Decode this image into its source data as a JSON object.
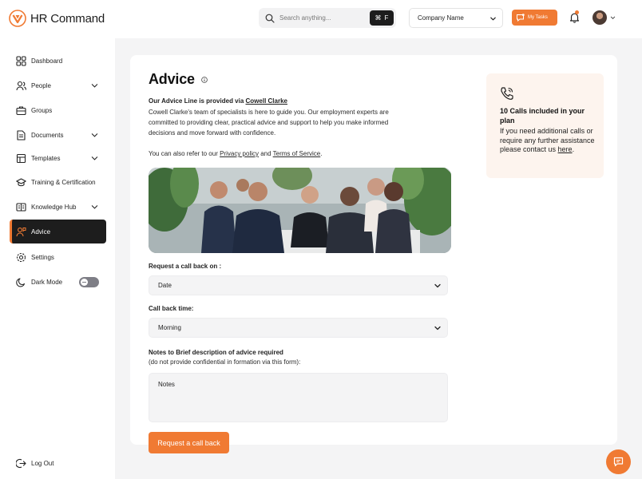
{
  "brand": {
    "name": "HR Command",
    "accent": "#f07a33",
    "dark": "#1d1d1d"
  },
  "header": {
    "search_placeholder": "Search anything...",
    "shortcut_symbol": "⌘",
    "shortcut_key": "F",
    "company_select": "Company Name",
    "tasks_label": "My Tasks",
    "icons": [
      "search-icon",
      "chevron-down-icon",
      "chat-icon",
      "bell-icon",
      "avatar"
    ]
  },
  "sidebar": {
    "items": [
      {
        "label": "Dashboard",
        "icon": "dashboard-icon",
        "has_chevron": false
      },
      {
        "label": "People",
        "icon": "people-icon",
        "has_chevron": true
      },
      {
        "label": "Groups",
        "icon": "briefcase-icon",
        "has_chevron": false
      },
      {
        "label": "Documents",
        "icon": "document-icon",
        "has_chevron": true
      },
      {
        "label": "Templates",
        "icon": "template-icon",
        "has_chevron": true
      },
      {
        "label": "Training & Certification",
        "icon": "graduation-cap-icon",
        "has_chevron": false
      },
      {
        "label": "Knowledge Hub",
        "icon": "book-icon",
        "has_chevron": true
      },
      {
        "label": "Advice",
        "icon": "advice-icon",
        "has_chevron": false,
        "active": true
      },
      {
        "label": "Settings",
        "icon": "gear-icon",
        "has_chevron": false
      },
      {
        "label": "Dark Mode",
        "icon": "moon-icon",
        "has_chevron": false
      }
    ],
    "dark_mode_on": false,
    "logout": "Log Out"
  },
  "page": {
    "title": "Advice",
    "intro_heading_prefix": "Our Advice Line is provided via ",
    "intro_heading_link": "Cowell Clarke",
    "intro_body": "Cowell Clarke's team of specialists is here to guide you. Our employment experts are committed to providing clear, practical advice and support to help you make informed decisions and move forward with confidence.",
    "refer_prefix": "You can also refer to our ",
    "privacy_link": "Privacy policy",
    "refer_and": " and ",
    "terms_link": "Terms of Service",
    "refer_suffix": ".",
    "form": {
      "callback_label": "Request a call back on :",
      "callback_value": "Date",
      "time_label": "Call back time:",
      "time_value": "Morning",
      "notes_label": "Notes to Brief description of advice required",
      "notes_sublabel": "(do not provide confidential in formation via this form):",
      "notes_placeholder": "Notes",
      "submit": "Request a call back"
    }
  },
  "plan": {
    "title": "10 Calls included in your plan",
    "body_prefix": "If you need additional calls or require any further assistance please contact us ",
    "link": "here",
    "body_suffix": "."
  }
}
